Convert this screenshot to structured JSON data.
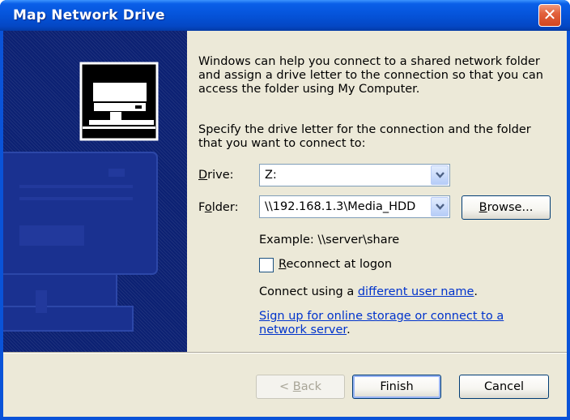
{
  "window": {
    "title": "Map Network Drive",
    "close_glyph": "✕"
  },
  "intro_text": "Windows can help you connect to a shared network folder and assign a drive letter to the connection so that you can access the folder using My Computer.",
  "specify_text": "Specify the drive letter for the connection and the folder that you want to connect to:",
  "drive": {
    "label_u": "D",
    "label_rest": "rive:",
    "value": "Z:"
  },
  "folder": {
    "label_pre": "F",
    "label_u": "o",
    "label_rest": "lder:",
    "value": "\\\\192.168.1.3\\Media_HDD"
  },
  "browse": {
    "label_u": "B",
    "label_rest": "rowse..."
  },
  "example_text": "Example: \\\\server\\share",
  "reconnect": {
    "label_u": "R",
    "label_rest": "econnect at logon",
    "checked": false
  },
  "connect_using": {
    "prefix": "Connect using a ",
    "link": "different user name",
    "suffix": "."
  },
  "signup": {
    "line1": "Sign up for online storage or connect to a",
    "line2": "network server",
    "suffix": "."
  },
  "buttons": {
    "back_pre": "< ",
    "back_u": "B",
    "back_rest": "ack",
    "finish": "Finish",
    "cancel": "Cancel"
  },
  "icons": {
    "close": "close-icon",
    "drive": "network-drive-icon",
    "dropdown": "chevron-down-icon"
  },
  "colors": {
    "titlebar": "#0553d9",
    "side_panel": "#0c2173",
    "dialog_bg": "#ece9d8",
    "link": "#0033cc",
    "close": "#d2451e"
  }
}
